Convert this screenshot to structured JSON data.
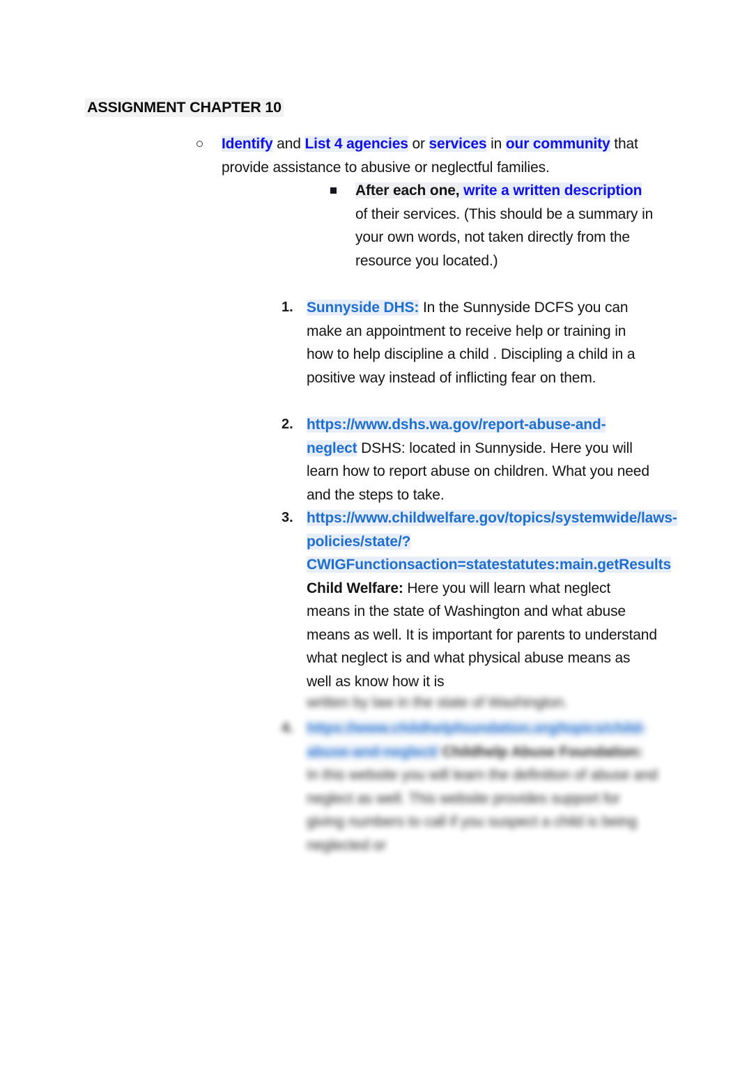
{
  "document": {
    "title": "ASSIGNMENT CHAPTER 10"
  },
  "prompt": {
    "bullet_glyph": "circle-bullet",
    "run1": "Identify",
    "run2": " and ",
    "run3": " List 4 agencies",
    "run4": " or ",
    "run5": "services",
    "run6": " in ",
    "run7": "our community",
    "run8": " that provide assistance to abusive or neglectful families."
  },
  "subprompt": {
    "bullet_glyph": "square-bullet",
    "run1": "After each one, ",
    "run2": " write a written description",
    "run3": " of their services. (This should be a summary in your own words, not taken directly from the resource you located.)"
  },
  "agencies": [
    {
      "marker": "1.",
      "label": "Sunnyside DHS:",
      "label_style": "link",
      "description": " In the Sunnyside DCFS you can make an appointment to receive help or training in how to help discipline a child . Discipling a child in a positive way instead of inflicting fear on them."
    },
    {
      "marker": "2.",
      "label": "https://www.dshs.wa.gov/report-abuse-and-neglect",
      "label_style": "link",
      "description": " DSHS: located in Sunnyside. Here you will learn how to report abuse on children. What you need and the steps to take."
    },
    {
      "marker": "3.",
      "label": "https://www.childwelfare.gov/topics/systemwide/laws-policies/state/?CWIGFunctionsaction=statestatutes:main.getResults",
      "label_style": "link",
      "bold_name": " Child Welfare:",
      "description": " Here you will learn what neglect means in the state of Washington and what abuse means as well. It is important for parents to understand what neglect is and what physical abuse means as well as know how it is",
      "description_blurred_tail": " written by law in the state of Washington."
    },
    {
      "marker": "4.",
      "label": "https://www.childhelpfoundation.org/topics/child-abuse-and-neglect/",
      "label_style": "link",
      "bold_name": " Childhelp Abuse Foundation:",
      "description": " In this website you will learn the definition of abuse and neglect as well. This website provides support for giving numbers to call if you suspect a child is being neglected or",
      "redacted": true
    }
  ],
  "colors": {
    "accent_blue": "#1010e8",
    "hyperlink_blue": "#1f6fd0",
    "text": "#141414",
    "highlight": "#efeff3",
    "page_background": "#ffffff"
  }
}
